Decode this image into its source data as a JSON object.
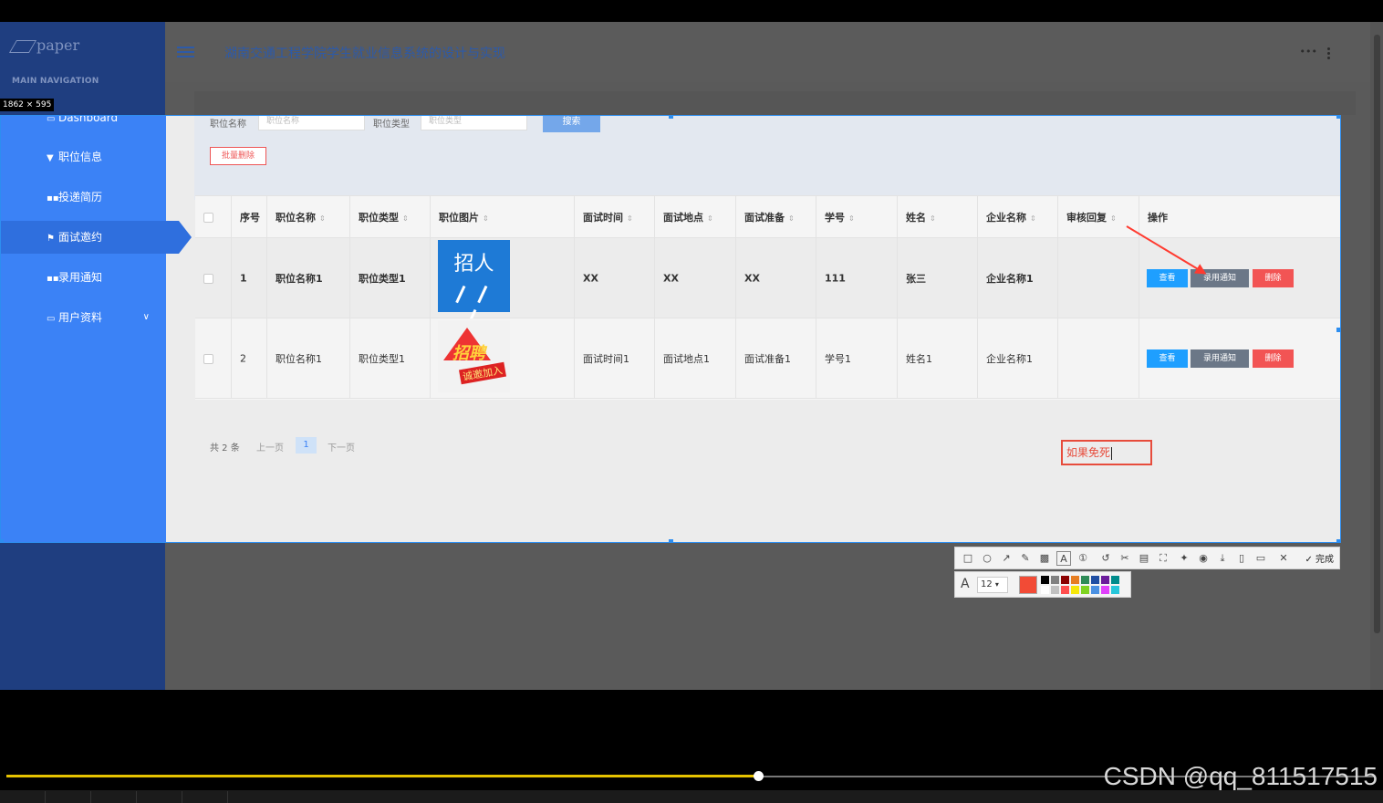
{
  "screen_label": "1862 × 595",
  "app": {
    "logo_text": "paper",
    "main_navigation": "MAIN NAVIGATION",
    "title": "湖南交通工程学院学生就业信息系统的设计与实现",
    "header_right": "•••"
  },
  "sidebar": {
    "items": [
      {
        "label": "Dashboard",
        "icon": "dashboard-icon",
        "glyph": "▭"
      },
      {
        "label": "职位信息",
        "icon": "flag-icon",
        "glyph": "▼"
      },
      {
        "label": "投递简历",
        "icon": "grid-icon",
        "glyph": "▪▪"
      },
      {
        "label": "面试邀约",
        "icon": "flag-icon",
        "glyph": "⚑",
        "active": true
      },
      {
        "label": "录用通知",
        "icon": "grid-icon",
        "glyph": "▪▪"
      },
      {
        "label": "用户资料",
        "icon": "calendar-icon",
        "glyph": "▭",
        "chevron": "∨"
      }
    ]
  },
  "search": {
    "field1_label": "职位名称",
    "field1_placeholder": "职位名称",
    "field2_label": "职位类型",
    "field2_placeholder": "职位类型",
    "search_button": "搜索",
    "batch_delete": "批量删除"
  },
  "table": {
    "columns": [
      "序号",
      "职位名称",
      "职位类型",
      "职位图片",
      "面试时间",
      "面试地点",
      "面试准备",
      "学号",
      "姓名",
      "企业名称",
      "审核回复",
      "操作"
    ],
    "sort_glyph": "⇕",
    "rows": [
      {
        "no": "1",
        "job_name": "职位名称1",
        "job_type": "职位类型1",
        "image_caption": "招人",
        "time": "XX",
        "place": "XX",
        "prep": "XX",
        "student_no": "111",
        "name": "张三",
        "company": "企业名称1",
        "reply": ""
      },
      {
        "no": "2",
        "job_name": "职位名称1",
        "job_type": "职位类型1",
        "image_caption": "招聘",
        "image_sub": "诚邀加入",
        "time": "面试时间1",
        "place": "面试地点1",
        "prep": "面试准备1",
        "student_no": "学号1",
        "name": "姓名1",
        "company": "企业名称1",
        "reply": ""
      }
    ],
    "actions": {
      "view": "查看",
      "notice": "录用通知",
      "delete": "删除"
    }
  },
  "pager": {
    "total": "共 2 条",
    "prev": "上一页",
    "page": "1",
    "next": "下一页"
  },
  "annotation": {
    "text": "如果免死"
  },
  "toolbar": {
    "tools": [
      "rectangle-icon",
      "ellipse-icon",
      "arrow-icon",
      "pen-icon",
      "mosaic-icon",
      "text-icon",
      "number-icon",
      "undo-icon",
      "scissor-icon",
      "ocr-icon",
      "translate-icon",
      "pin-icon",
      "record-icon",
      "download-icon",
      "save-icon",
      "bookmark-icon",
      "close-icon"
    ],
    "done_label": "完成",
    "font_size": "12",
    "current_color": "#f24b36",
    "palette": [
      "#000000",
      "#808080",
      "#8b0000",
      "#e67e22",
      "#2e8b57",
      "#1f4ea3",
      "#6a1b9a",
      "#008b8b",
      "#ffffff",
      "#c0c0c0",
      "#ff4d4d",
      "#f5e60a",
      "#7ed321",
      "#4a90e2",
      "#e040fb",
      "#26c6da"
    ]
  },
  "watermark": "CSDN @qq_811517515"
}
